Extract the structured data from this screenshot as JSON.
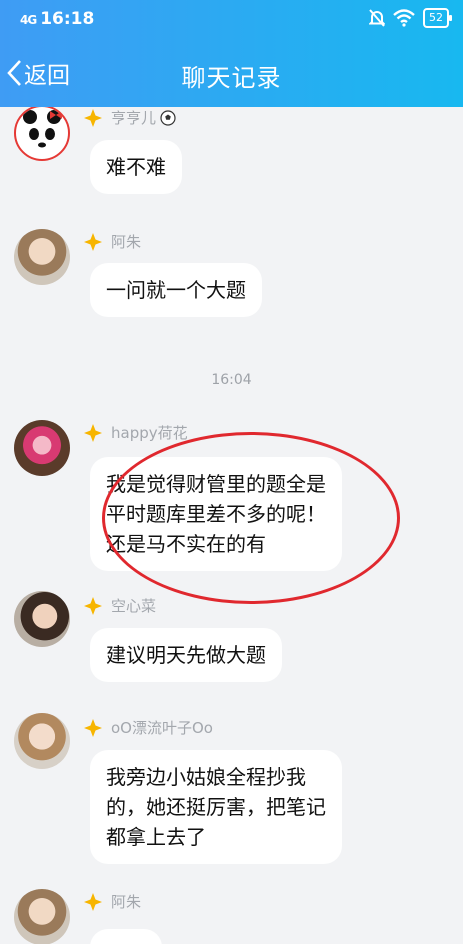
{
  "status": {
    "signal": "4G",
    "time": "16:18",
    "battery": "52"
  },
  "nav": {
    "back_label": "返回",
    "title": "聊天记录"
  },
  "messages": [
    {
      "sender": "亨亨儿",
      "text": "难不难"
    },
    {
      "sender": "阿朱",
      "text": "一问就一个大题"
    },
    {
      "sender": "happy荷花",
      "text": "我是觉得财管里的题全是\n平时题库里差不多的呢！\n还是马不实在的有"
    },
    {
      "sender": "空心菜",
      "text": "建议明天先做大题"
    },
    {
      "sender": "oO漂流叶子Oo",
      "text": "我旁边小姑娘全程抄我\n的，她还挺厉害，把笔记\n都拿上去了"
    },
    {
      "sender": "阿朱",
      "text": ""
    }
  ],
  "timestamp": "16:04",
  "colors": {
    "topbar_start": "#3f9cf4",
    "topbar_end": "#18b8f0",
    "annotation_circle": "#e0282e",
    "badge": "#f7b500"
  },
  "icons": [
    "signal-icon",
    "mute-bell-icon",
    "wifi-icon",
    "battery-icon",
    "back-chevron-icon",
    "rank-badge-icon",
    "soccer-ball-icon"
  ]
}
